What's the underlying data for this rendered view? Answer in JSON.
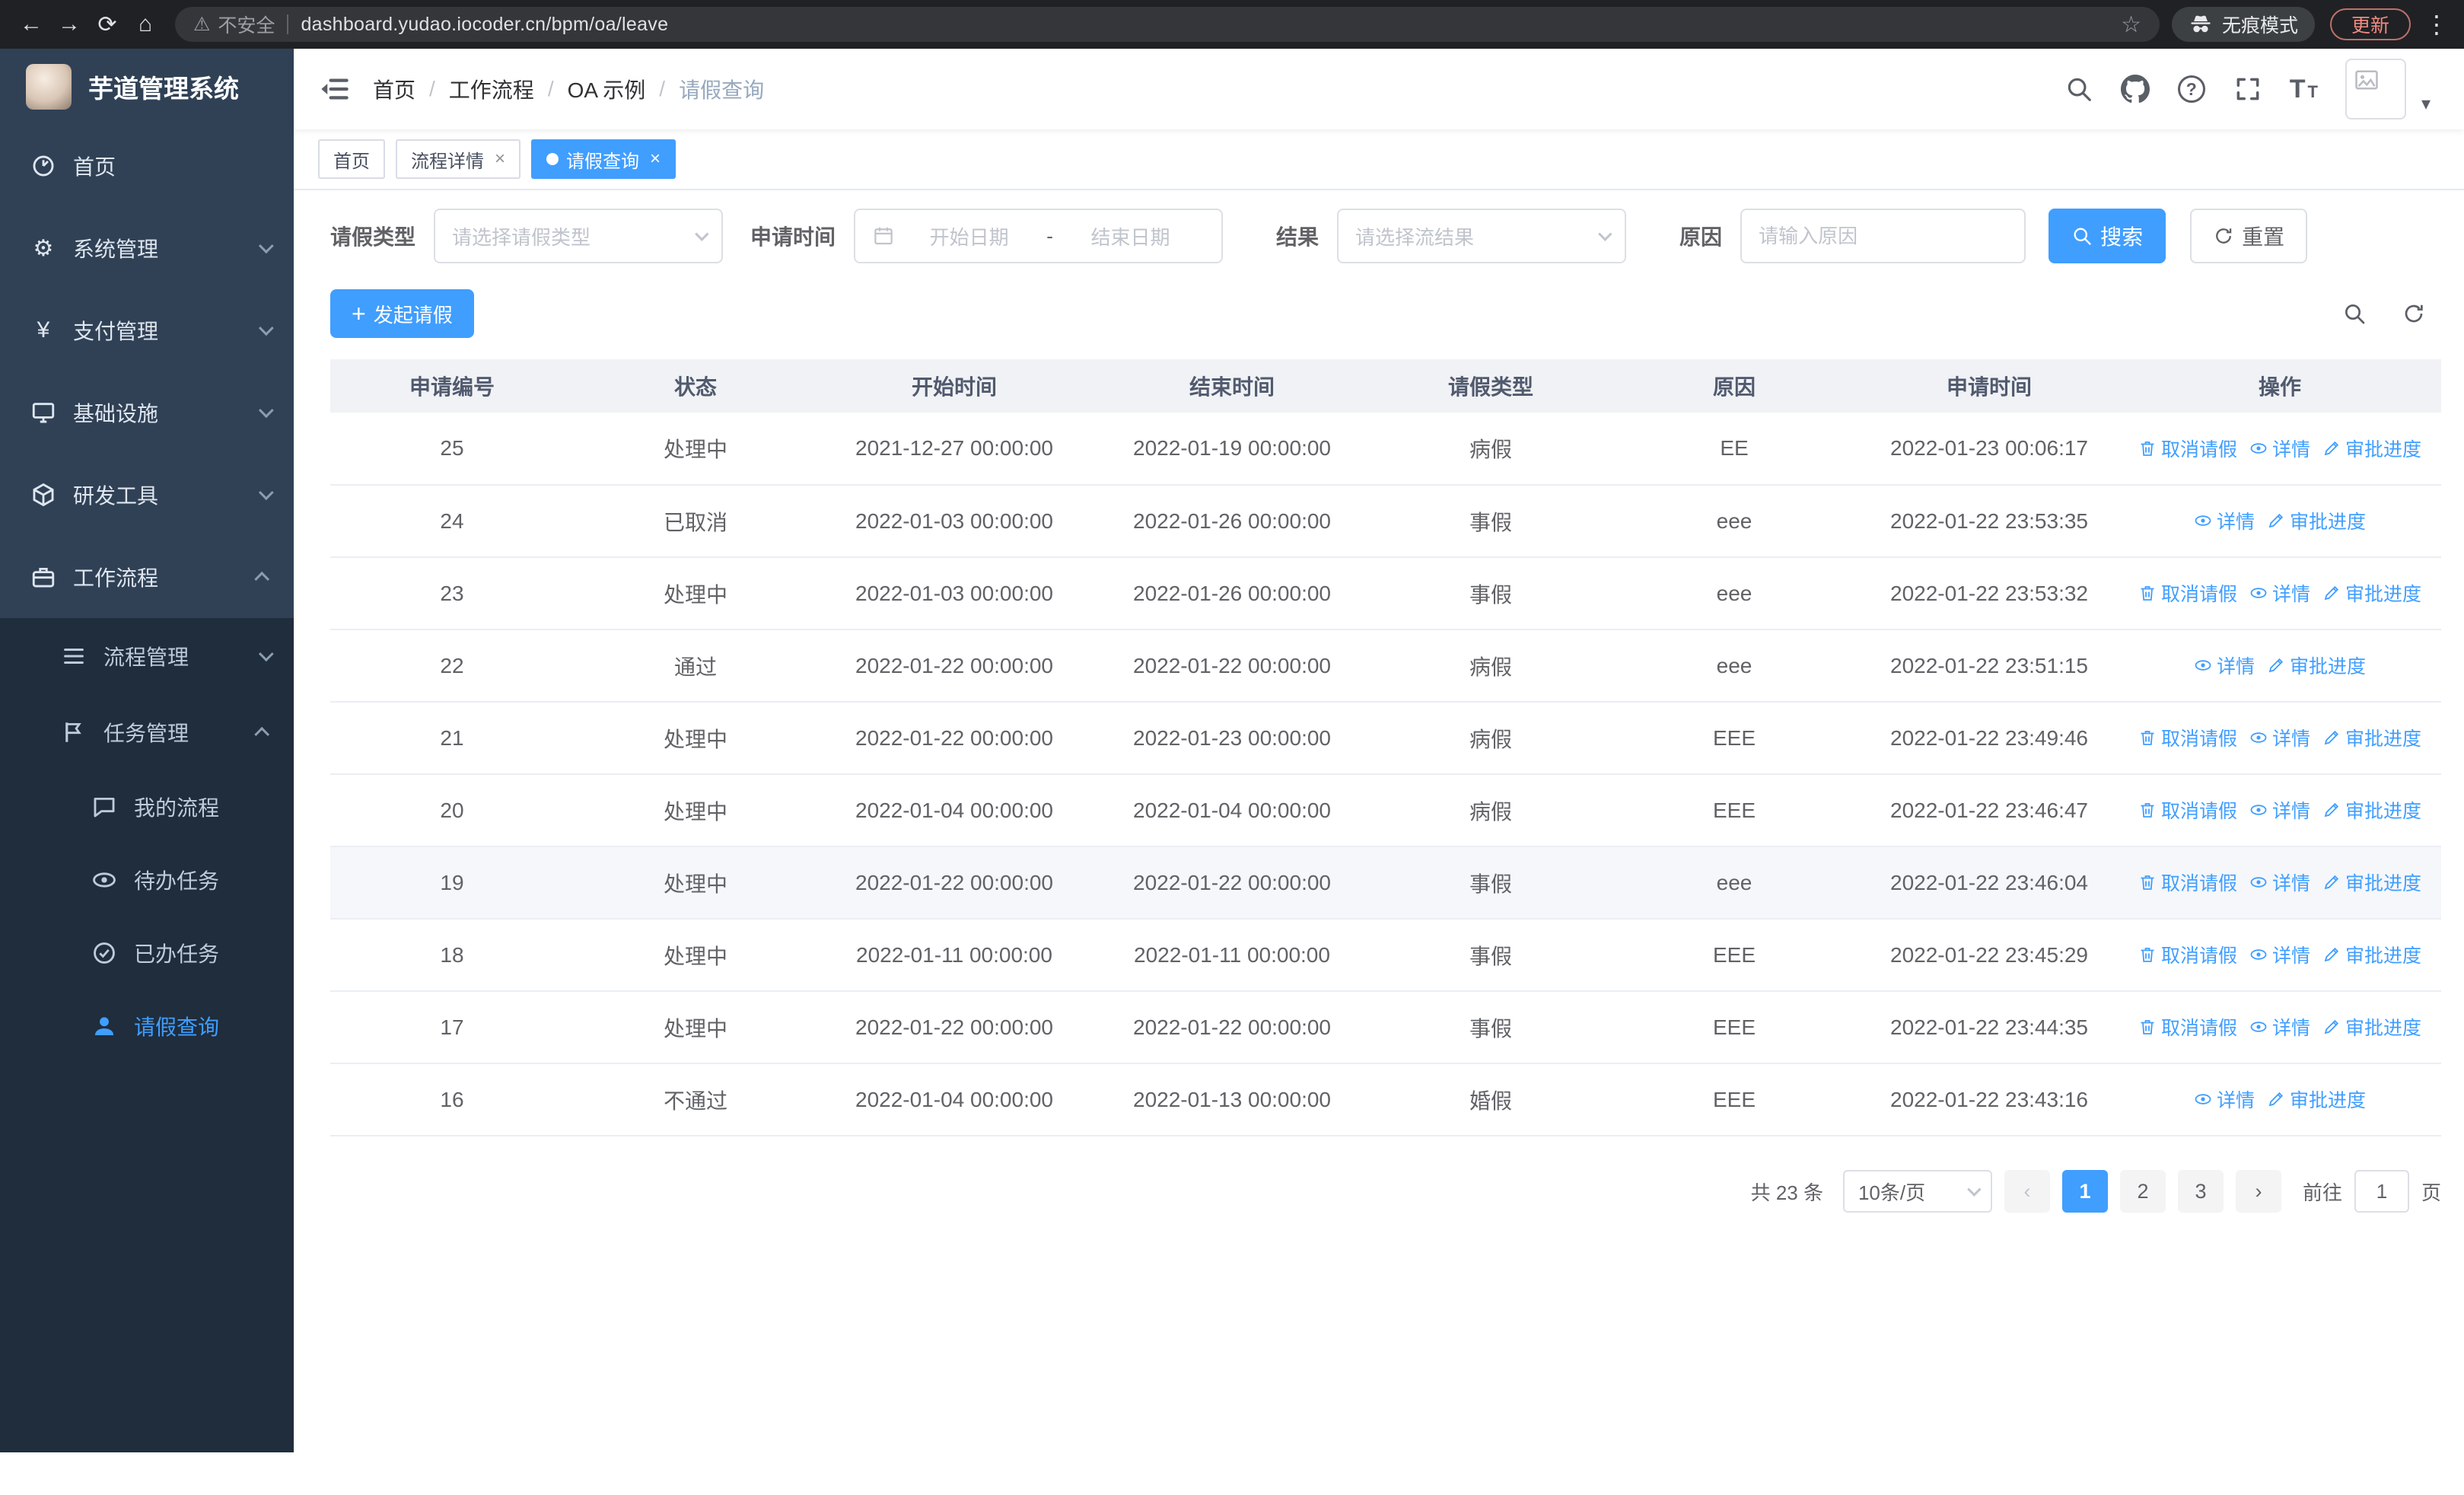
{
  "colors": {
    "primary": "#409eff",
    "sidebar_bg": "#304156",
    "sidebar_submenu_bg": "#1f2d3d",
    "table_header_bg": "#f0f2f5"
  },
  "browser": {
    "security_label": "不安全",
    "url": "dashboard.yudao.iocoder.cn/bpm/oa/leave",
    "incognito_label": "无痕模式",
    "update_label": "更新"
  },
  "icons": {
    "back": "←",
    "forward": "→",
    "reload": "⟳",
    "home": "⌂",
    "warning": "⚠",
    "star": "☆",
    "kebab": "⋮",
    "close": "×",
    "plus": "+",
    "question": "?",
    "font_large": "T",
    "font_small": "T",
    "prev": "‹",
    "next": "›",
    "caret": "▾",
    "gear": "⚙",
    "yen": "¥"
  },
  "sidebar": {
    "app_title": "芋道管理系统",
    "items": [
      {
        "label": "首页"
      },
      {
        "label": "系统管理"
      },
      {
        "label": "支付管理"
      },
      {
        "label": "基础设施"
      },
      {
        "label": "研发工具"
      },
      {
        "label": "工作流程"
      },
      {
        "label": "流程管理"
      },
      {
        "label": "任务管理"
      },
      {
        "label": "我的流程"
      },
      {
        "label": "待办任务"
      },
      {
        "label": "已办任务"
      },
      {
        "label": "请假查询"
      }
    ]
  },
  "breadcrumb": {
    "separator": "/",
    "items": [
      "首页",
      "工作流程",
      "OA 示例",
      "请假查询"
    ]
  },
  "tabs": [
    {
      "label": "首页"
    },
    {
      "label": "流程详情"
    },
    {
      "label": "请假查询"
    }
  ],
  "filters": {
    "leave_type_label": "请假类型",
    "leave_type_placeholder": "请选择请假类型",
    "apply_time_label": "申请时间",
    "start_date_placeholder": "开始日期",
    "range_separator": "-",
    "end_date_placeholder": "结束日期",
    "result_label": "结果",
    "result_placeholder": "请选择流结果",
    "reason_label": "原因",
    "reason_placeholder": "请输入原因",
    "search_label": "搜索",
    "reset_label": "重置"
  },
  "toolbar": {
    "create_label": "发起请假"
  },
  "table": {
    "columns": [
      "申请编号",
      "状态",
      "开始时间",
      "结束时间",
      "请假类型",
      "原因",
      "申请时间",
      "操作"
    ],
    "action_labels": {
      "cancel": "取消请假",
      "detail": "详情",
      "progress": "审批进度"
    },
    "rows": [
      {
        "id": "25",
        "status": "处理中",
        "start": "2021-12-27 00:00:00",
        "end": "2022-01-19 00:00:00",
        "type": "病假",
        "reason": "EE",
        "apply_time": "2022-01-23 00:06:17",
        "actions": [
          "cancel",
          "detail",
          "progress"
        ],
        "highlight": false
      },
      {
        "id": "24",
        "status": "已取消",
        "start": "2022-01-03 00:00:00",
        "end": "2022-01-26 00:00:00",
        "type": "事假",
        "reason": "eee",
        "apply_time": "2022-01-22 23:53:35",
        "actions": [
          "detail",
          "progress"
        ],
        "highlight": false
      },
      {
        "id": "23",
        "status": "处理中",
        "start": "2022-01-03 00:00:00",
        "end": "2022-01-26 00:00:00",
        "type": "事假",
        "reason": "eee",
        "apply_time": "2022-01-22 23:53:32",
        "actions": [
          "cancel",
          "detail",
          "progress"
        ],
        "highlight": false
      },
      {
        "id": "22",
        "status": "通过",
        "start": "2022-01-22 00:00:00",
        "end": "2022-01-22 00:00:00",
        "type": "病假",
        "reason": "eee",
        "apply_time": "2022-01-22 23:51:15",
        "actions": [
          "detail",
          "progress"
        ],
        "highlight": false
      },
      {
        "id": "21",
        "status": "处理中",
        "start": "2022-01-22 00:00:00",
        "end": "2022-01-23 00:00:00",
        "type": "病假",
        "reason": "EEE",
        "apply_time": "2022-01-22 23:49:46",
        "actions": [
          "cancel",
          "detail",
          "progress"
        ],
        "highlight": false
      },
      {
        "id": "20",
        "status": "处理中",
        "start": "2022-01-04 00:00:00",
        "end": "2022-01-04 00:00:00",
        "type": "病假",
        "reason": "EEE",
        "apply_time": "2022-01-22 23:46:47",
        "actions": [
          "cancel",
          "detail",
          "progress"
        ],
        "highlight": false
      },
      {
        "id": "19",
        "status": "处理中",
        "start": "2022-01-22 00:00:00",
        "end": "2022-01-22 00:00:00",
        "type": "事假",
        "reason": "eee",
        "apply_time": "2022-01-22 23:46:04",
        "actions": [
          "cancel",
          "detail",
          "progress"
        ],
        "highlight": true
      },
      {
        "id": "18",
        "status": "处理中",
        "start": "2022-01-11 00:00:00",
        "end": "2022-01-11 00:00:00",
        "type": "事假",
        "reason": "EEE",
        "apply_time": "2022-01-22 23:45:29",
        "actions": [
          "cancel",
          "detail",
          "progress"
        ],
        "highlight": false
      },
      {
        "id": "17",
        "status": "处理中",
        "start": "2022-01-22 00:00:00",
        "end": "2022-01-22 00:00:00",
        "type": "事假",
        "reason": "EEE",
        "apply_time": "2022-01-22 23:44:35",
        "actions": [
          "cancel",
          "detail",
          "progress"
        ],
        "highlight": false
      },
      {
        "id": "16",
        "status": "不通过",
        "start": "2022-01-04 00:00:00",
        "end": "2022-01-13 00:00:00",
        "type": "婚假",
        "reason": "EEE",
        "apply_time": "2022-01-22 23:43:16",
        "actions": [
          "detail",
          "progress"
        ],
        "highlight": false
      }
    ]
  },
  "pagination": {
    "total": "共 23 条",
    "page_size": "10条/页",
    "pages": [
      "1",
      "2",
      "3"
    ],
    "goto_label": "前往",
    "goto_value": "1",
    "goto_unit": "页"
  }
}
